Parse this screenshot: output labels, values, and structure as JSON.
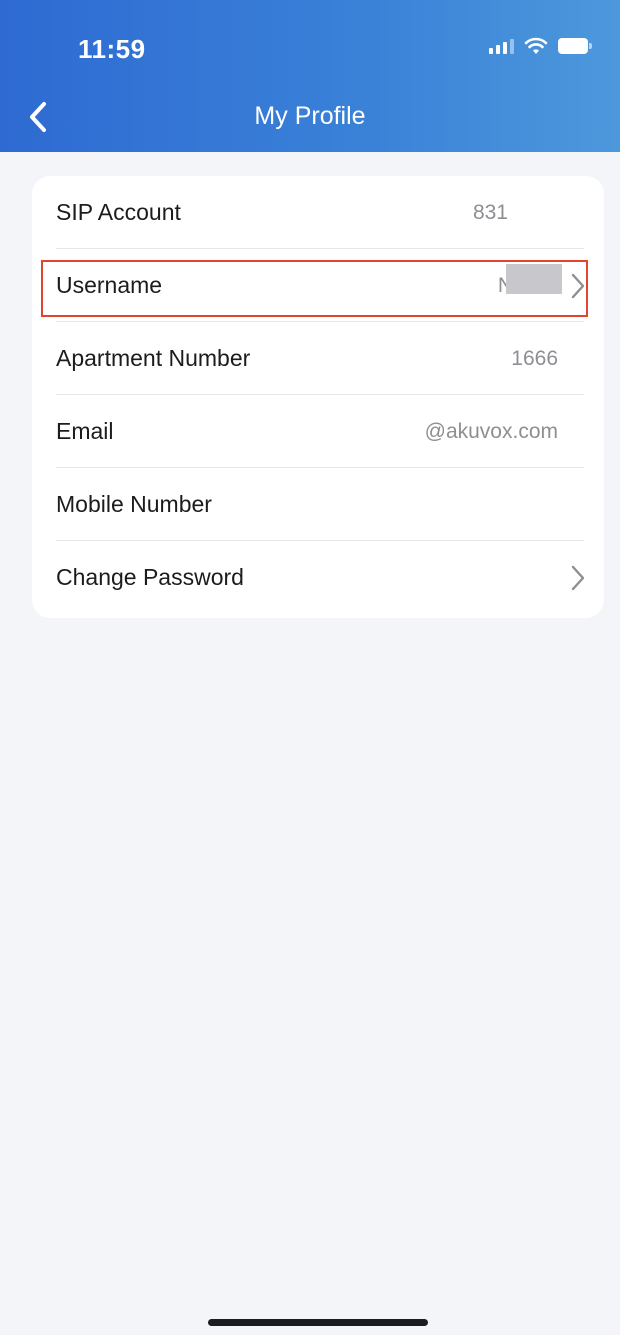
{
  "status_bar": {
    "time": "11:59"
  },
  "header": {
    "title": "My Profile"
  },
  "profile_rows": [
    {
      "label": "SIP Account",
      "value": "831"
    },
    {
      "label": "Username",
      "value": "NIC"
    },
    {
      "label": "Apartment Number",
      "value": "1666"
    },
    {
      "label": "Email",
      "value": "@akuvox.com"
    },
    {
      "label": "Mobile Number",
      "value": ""
    },
    {
      "label": "Change Password",
      "value": ""
    }
  ],
  "colors": {
    "header_gradient_start": "#2e6ad2",
    "header_gradient_end": "#4d98dc",
    "highlight": "#e0452e",
    "background": "#f3f5f9"
  }
}
